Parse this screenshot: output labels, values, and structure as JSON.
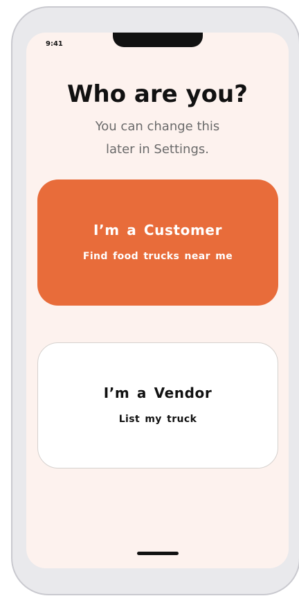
{
  "status_bar": {
    "time": "9:41"
  },
  "header": {
    "title": "Who are you?",
    "subtitle_line1": "You can change this",
    "subtitle_line2": "later in Settings."
  },
  "roles": {
    "customer": {
      "title": "I’m a Customer",
      "subtitle": "Find food trucks near me"
    },
    "vendor": {
      "title": "I’m a Vendor",
      "subtitle": "List my truck"
    }
  },
  "colors": {
    "accent": "#e86c3a",
    "background": "#fdf2ee",
    "card_background": "#ffffff",
    "text_primary": "#111111",
    "text_secondary": "#6a6a6a"
  }
}
